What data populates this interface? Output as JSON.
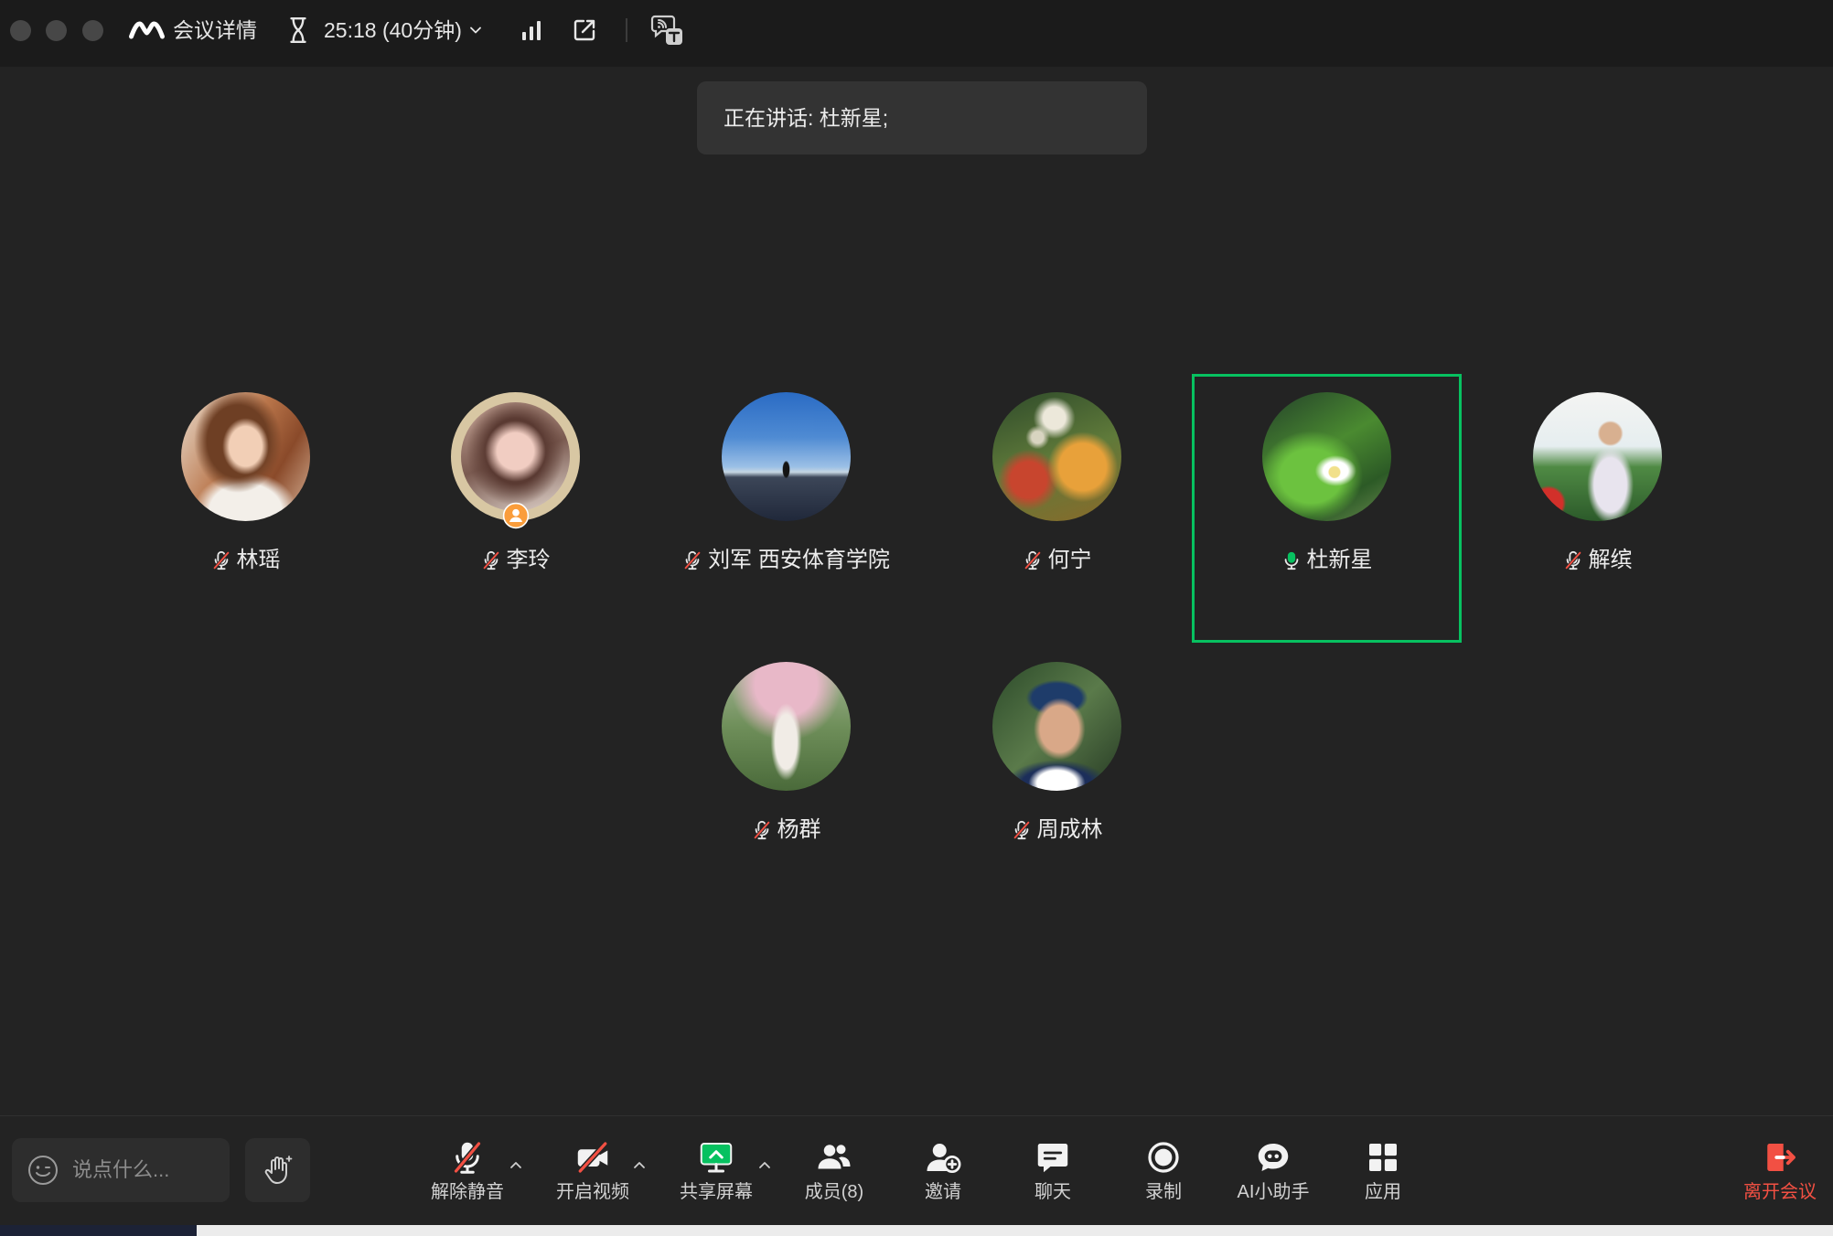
{
  "titlebar": {
    "meeting_info_label": "会议详情",
    "timer": "25:18 (40分钟)",
    "icons": [
      "meeting-logo-icon",
      "hourglass-icon",
      "chevron-down-icon",
      "signal-bars-icon",
      "external-window-icon",
      "transcript-icon"
    ]
  },
  "speaking_banner": {
    "text": "正在讲话: 杜新星;"
  },
  "participants": [
    {
      "name": "林瑶",
      "mic_icon": "mic-muted-icon"
    },
    {
      "name": "李玲",
      "mic_icon": "mic-muted-icon",
      "badge_icon": "host-badge-icon"
    },
    {
      "name": "刘军 西安体育学院",
      "mic_icon": "mic-muted-icon"
    },
    {
      "name": "何宁",
      "mic_icon": "mic-muted-icon"
    },
    {
      "name": "杜新星",
      "mic_icon": "mic-on-icon",
      "active_speaker": true
    },
    {
      "name": "解缤",
      "mic_icon": "mic-muted-icon"
    },
    {
      "name": "杨群",
      "mic_icon": "mic-muted-icon"
    },
    {
      "name": "周成林",
      "mic_icon": "mic-muted-icon"
    }
  ],
  "chat_input": {
    "placeholder": "说点什么...",
    "icon": "emoji-icon"
  },
  "raise_hand": {
    "icon": "raise-hand-icon"
  },
  "toolbar": {
    "unmute": {
      "label": "解除静音",
      "icon": "mic-muted-icon",
      "has_menu": true
    },
    "start_video": {
      "label": "开启视频",
      "icon": "video-off-icon",
      "has_menu": true
    },
    "share_screen": {
      "label": "共享屏幕",
      "icon": "share-screen-icon",
      "has_menu": true
    },
    "members": {
      "label": "成员(8)",
      "icon": "members-icon"
    },
    "invite": {
      "label": "邀请",
      "icon": "invite-icon"
    },
    "chat": {
      "label": "聊天",
      "icon": "chat-icon"
    },
    "record": {
      "label": "录制",
      "icon": "record-icon"
    },
    "ai_assistant": {
      "label": "AI小助手",
      "icon": "ai-assistant-icon"
    },
    "apps": {
      "label": "应用",
      "icon": "apps-icon"
    },
    "leave": {
      "label": "离开会议",
      "icon": "leave-icon"
    }
  },
  "colors": {
    "background": "#232323",
    "titlebar": "#1b1b1b",
    "accent": "#07c160",
    "muted_slash": "#f25043",
    "leave": "#f25043",
    "host_badge": "#fa9d3b"
  }
}
